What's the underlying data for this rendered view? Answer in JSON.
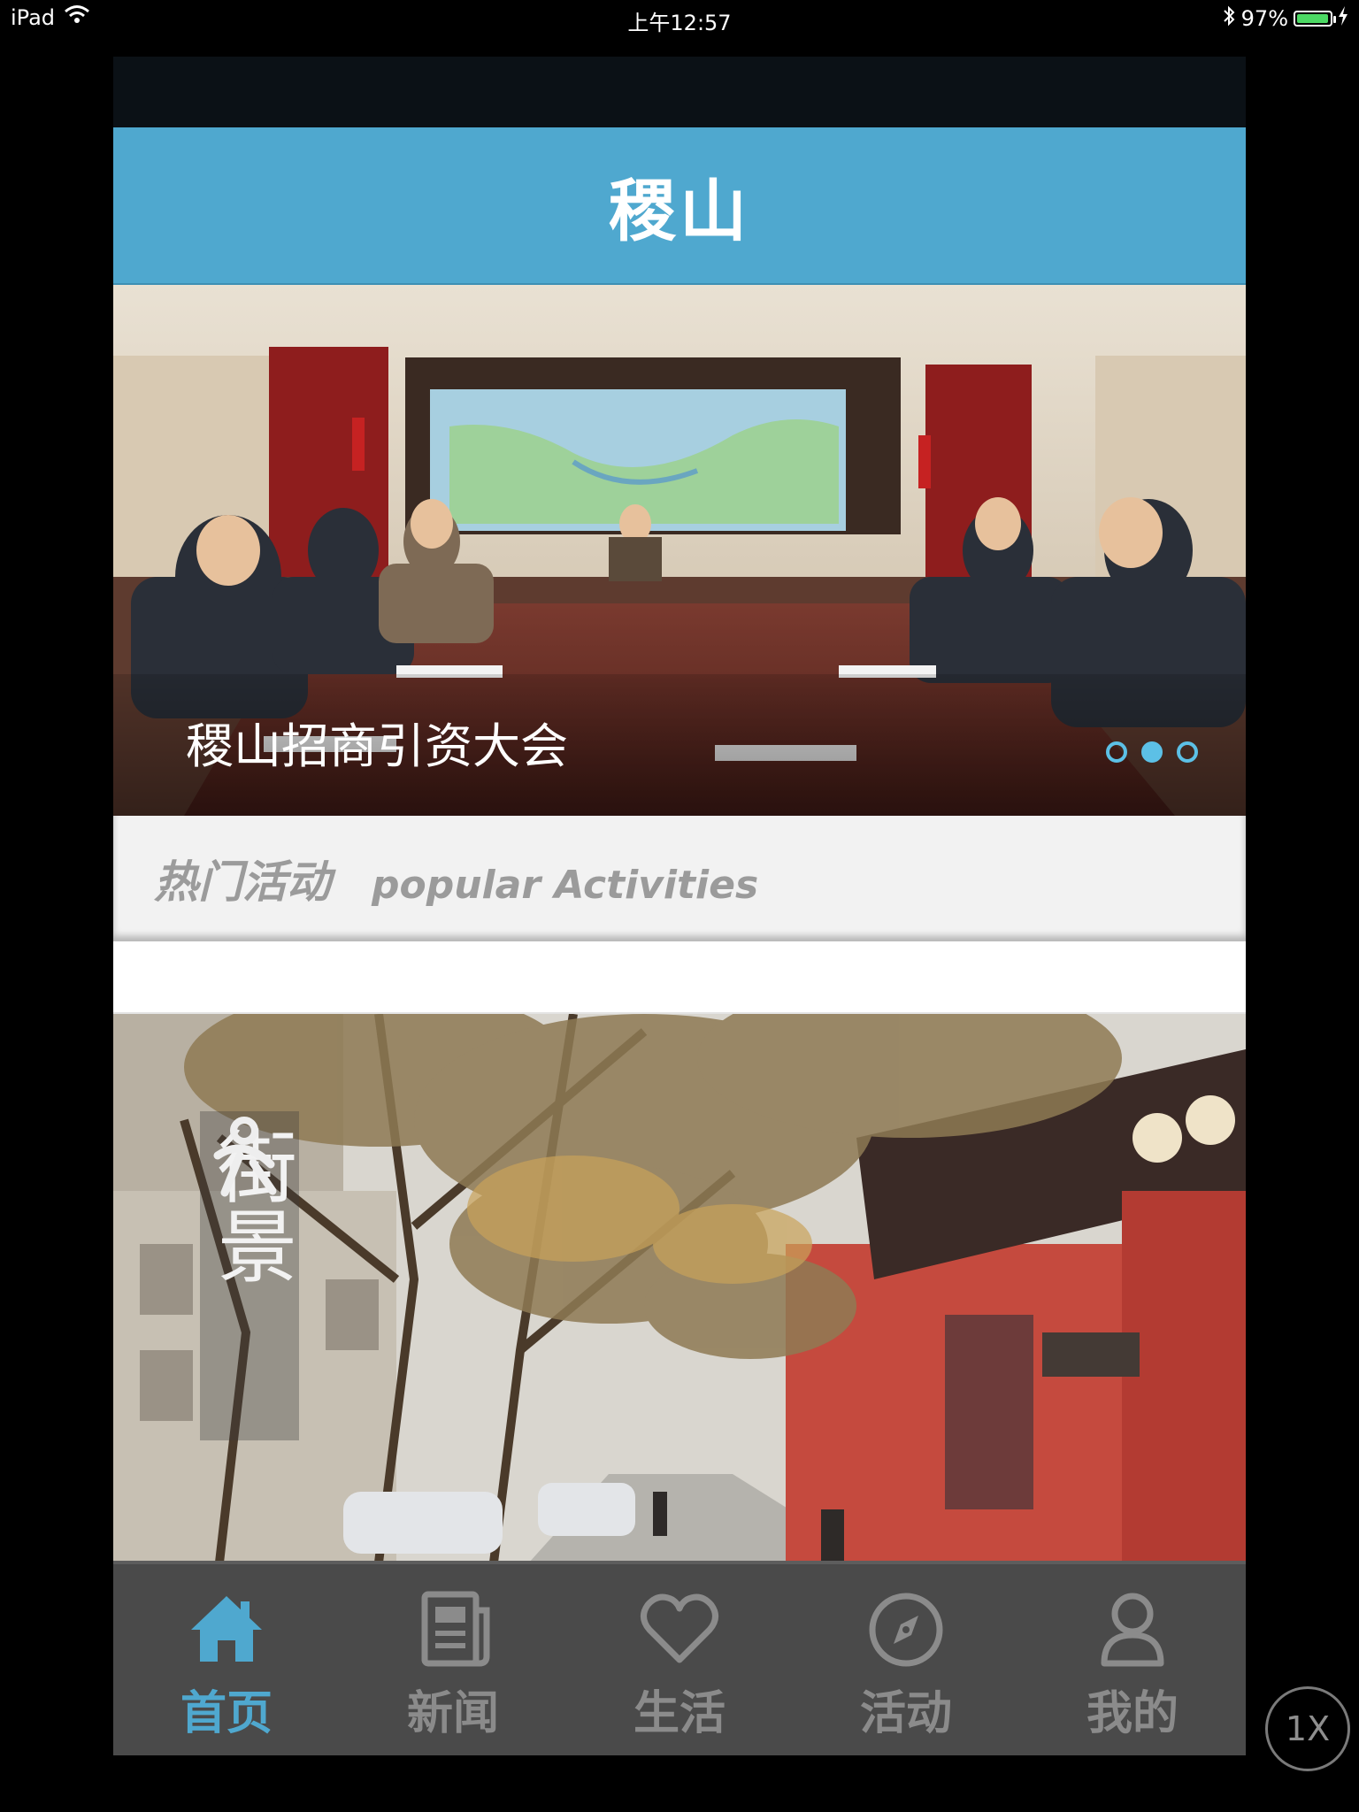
{
  "status_bar": {
    "device": "iPad",
    "time": "上午12:57",
    "battery_percent": "97%",
    "battery_level": 0.97
  },
  "header": {
    "title": "稷山"
  },
  "banner": {
    "caption": "稷山招商引资大会",
    "page_count": 3,
    "active_index": 1
  },
  "section": {
    "title_cn": "热门活动",
    "title_en": "popular Activities"
  },
  "activity": {
    "label": "街景"
  },
  "tabbar": {
    "items": [
      {
        "label": "首页",
        "icon": "home-icon",
        "active": true
      },
      {
        "label": "新闻",
        "icon": "news-icon",
        "active": false
      },
      {
        "label": "生活",
        "icon": "heart-icon",
        "active": false
      },
      {
        "label": "活动",
        "icon": "compass-icon",
        "active": false
      },
      {
        "label": "我的",
        "icon": "user-icon",
        "active": false
      }
    ]
  },
  "zoom_button": {
    "label": "1X"
  },
  "colors": {
    "accent": "#4fa8cf",
    "tabbar_bg": "#4a4a4a",
    "inactive_tab": "#8b8b8b",
    "section_bg": "#f2f2f2"
  }
}
